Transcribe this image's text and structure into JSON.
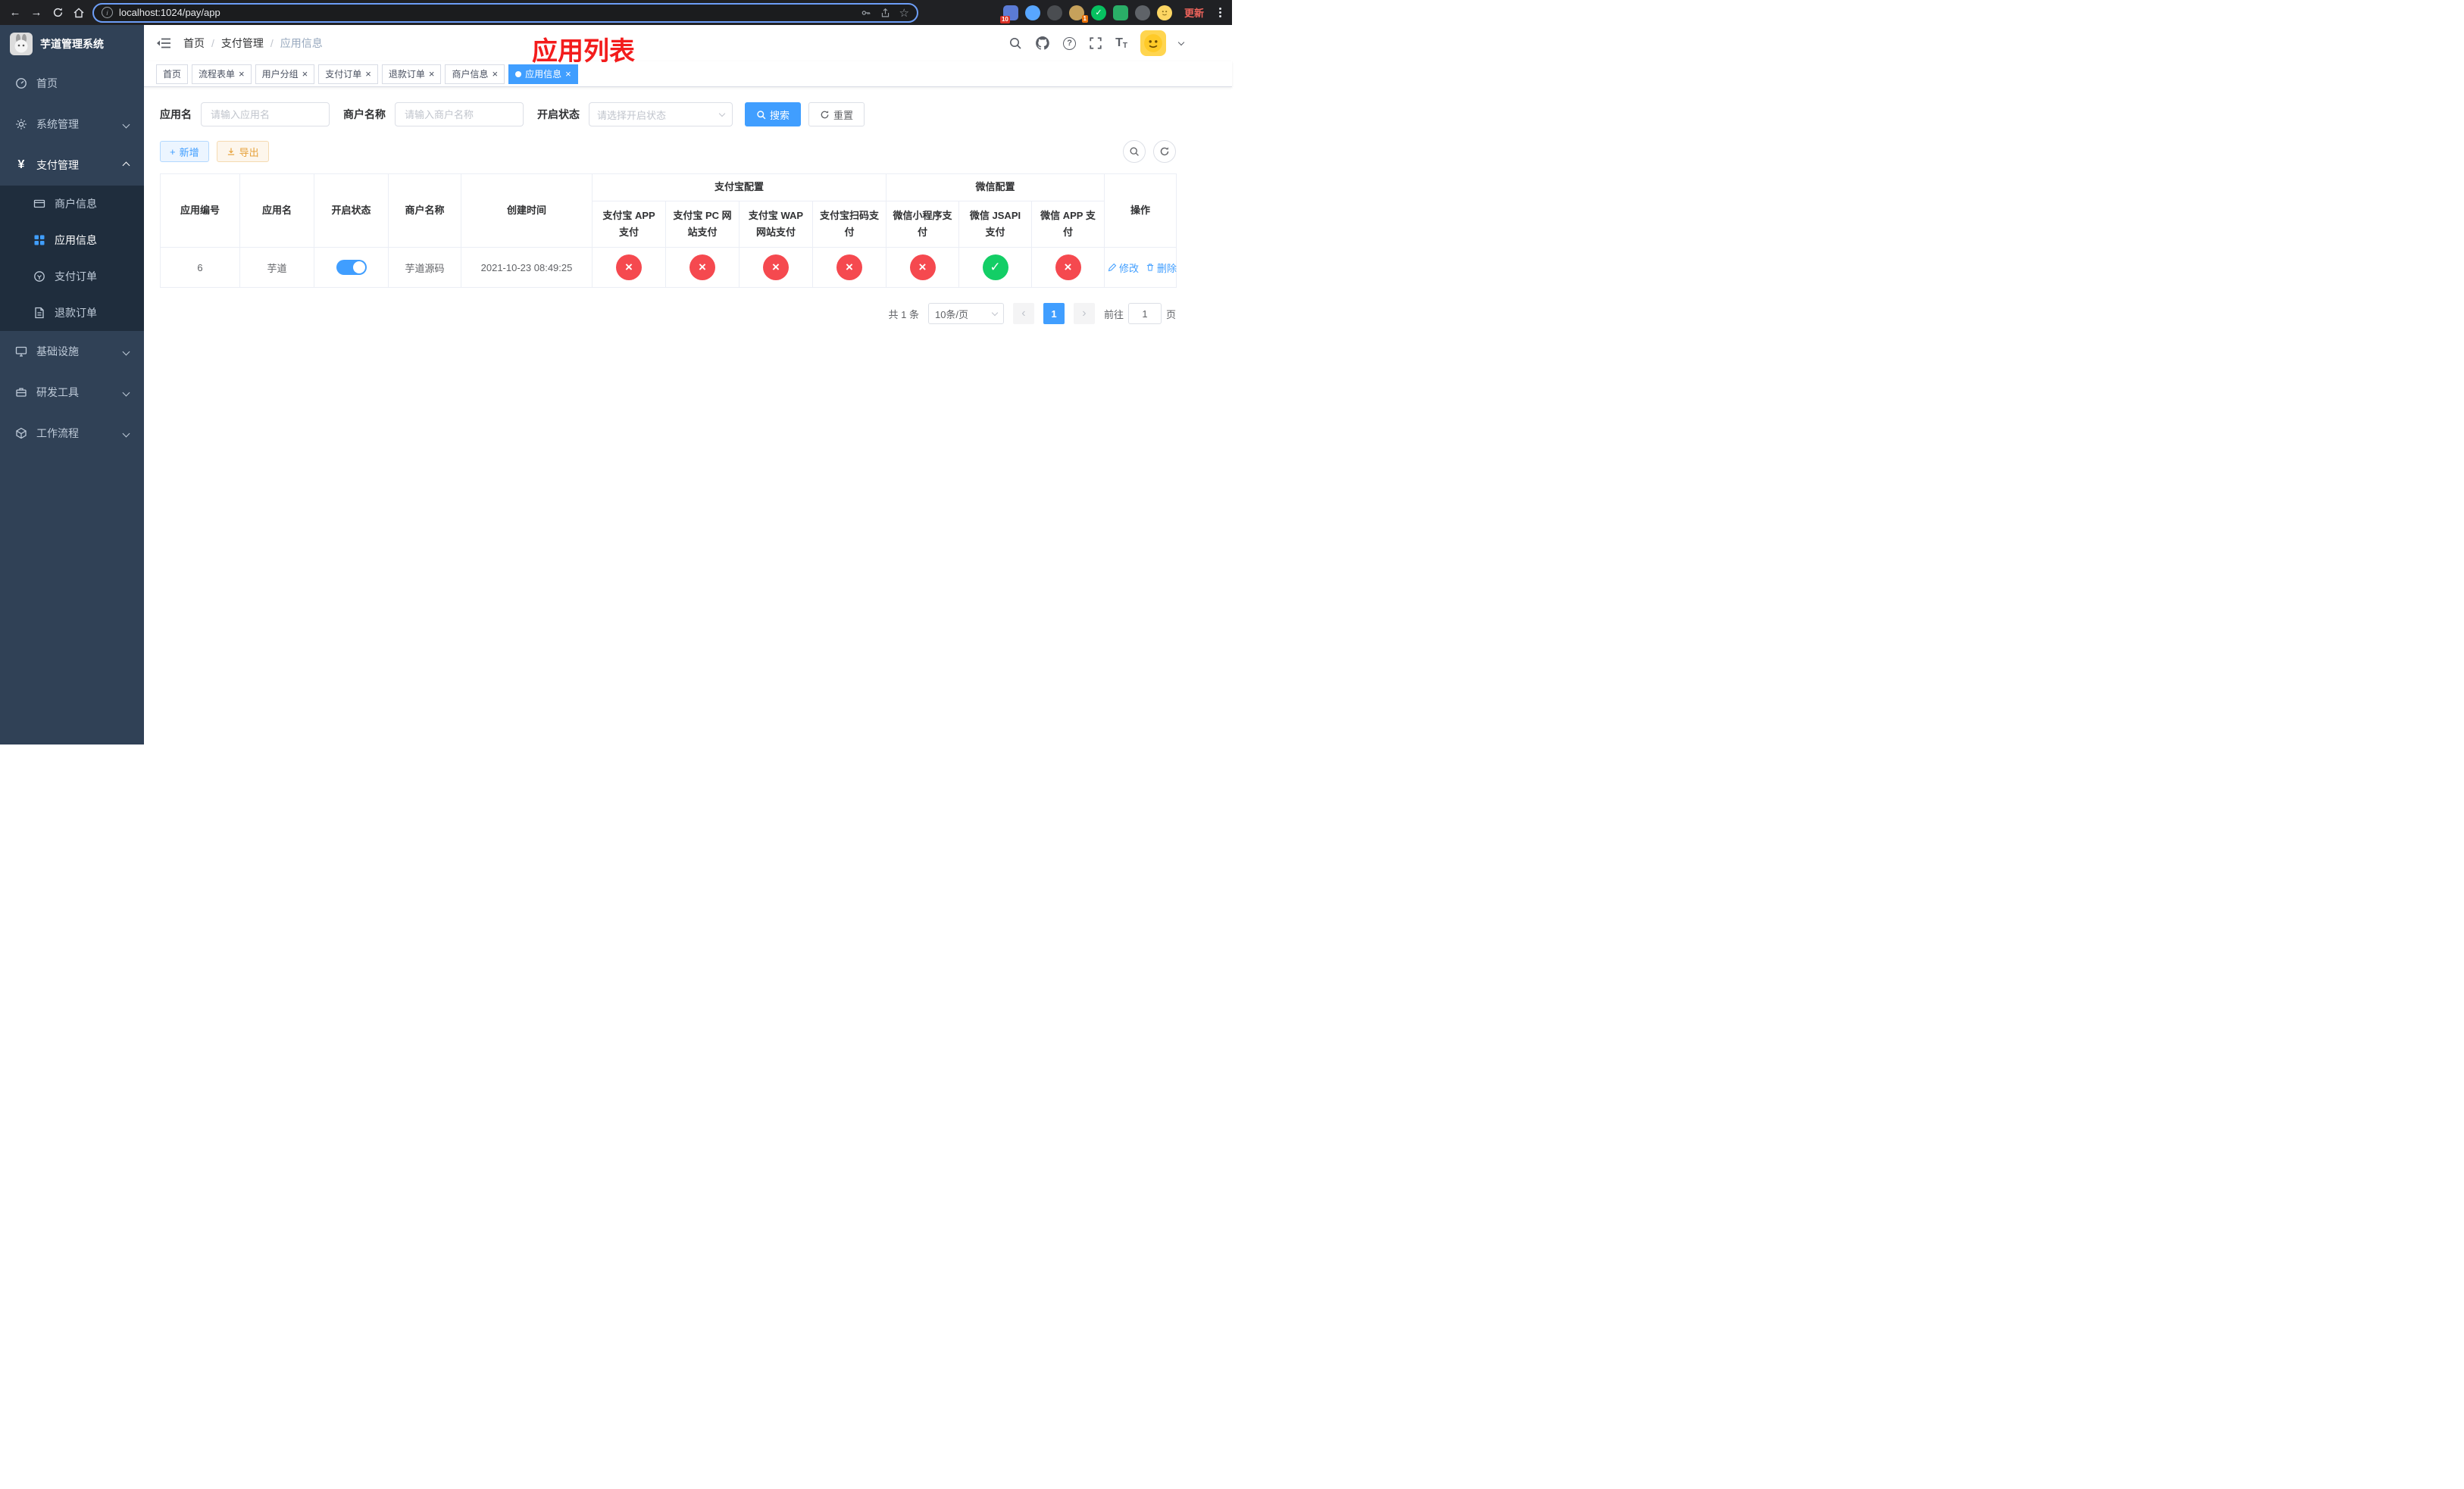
{
  "browser": {
    "url": "localhost:1024/pay/app",
    "update_label": "更新",
    "ext_pin_badge": "10",
    "ext_avatar_badge": "1"
  },
  "icons": {
    "back": "←",
    "forward": "→",
    "star": "☆",
    "info": "i",
    "help": "?",
    "close": "×",
    "check": "✓",
    "cross": "×",
    "prev": "‹",
    "next": "›",
    "plus": "+",
    "fontsize_large": "T",
    "fontsize_small": "T",
    "yen": "¥"
  },
  "sidebar": {
    "title": "芋道管理系统",
    "items": [
      {
        "label": "首页"
      },
      {
        "label": "系统管理"
      },
      {
        "label": "支付管理"
      },
      {
        "label": "基础设施"
      },
      {
        "label": "研发工具"
      },
      {
        "label": "工作流程"
      }
    ],
    "payment_children": [
      {
        "label": "商户信息"
      },
      {
        "label": "应用信息"
      },
      {
        "label": "支付订单"
      },
      {
        "label": "退款订单"
      }
    ]
  },
  "navbar": {
    "breadcrumb": [
      {
        "label": "首页"
      },
      {
        "label": "支付管理"
      },
      {
        "label": "应用信息"
      }
    ],
    "separator": "/",
    "annotation": "应用列表"
  },
  "tabs": [
    {
      "label": "首页"
    },
    {
      "label": "流程表单"
    },
    {
      "label": "用户分组"
    },
    {
      "label": "支付订单"
    },
    {
      "label": "退款订单"
    },
    {
      "label": "商户信息"
    },
    {
      "label": "应用信息"
    }
  ],
  "filters": {
    "app_name_label": "应用名",
    "app_name_placeholder": "请输入应用名",
    "merchant_label": "商户名称",
    "merchant_placeholder": "请输入商户名称",
    "status_label": "开启状态",
    "status_placeholder": "请选择开启状态",
    "search_label": "搜索",
    "reset_label": "重置"
  },
  "toolbar": {
    "add_label": "新增",
    "export_label": "导出"
  },
  "table": {
    "headers": {
      "app_no": "应用编号",
      "app_name": "应用名",
      "status": "开启状态",
      "merchant": "商户名称",
      "create_time": "创建时间",
      "alipay_group": "支付宝配置",
      "wechat_group": "微信配置",
      "alipay_app": "支付宝 APP 支付",
      "alipay_pc": "支付宝 PC 网站支付",
      "alipay_wap": "支付宝 WAP 网站支付",
      "alipay_qr": "支付宝扫码支付",
      "wechat_mini": "微信小程序支付",
      "wechat_jsapi": "微信 JSAPI 支付",
      "wechat_app": "微信 APP 支付",
      "actions": "操作"
    },
    "row": {
      "app_no": "6",
      "app_name": "芋道",
      "status_on": true,
      "merchant": "芋道源码",
      "create_time": "2021-10-23 08:49:25",
      "alipay_app": "fail",
      "alipay_pc": "fail",
      "alipay_wap": "fail",
      "alipay_qr": "fail",
      "wechat_mini": "fail",
      "wechat_jsapi": "success",
      "wechat_app": "fail",
      "edit_label": "修改",
      "delete_label": "删除"
    }
  },
  "pagination": {
    "total": "共 1 条",
    "page_size": "10条/页",
    "current_page": "1",
    "goto_label": "前往",
    "goto_value": "1",
    "goto_suffix": "页"
  },
  "colors": {
    "accent": "#409eff",
    "success": "#13ce66",
    "danger": "#f5494f",
    "sidebar_bg": "#304156",
    "submenu_bg": "#1f2d3d",
    "annotation": "#f31c1c"
  }
}
